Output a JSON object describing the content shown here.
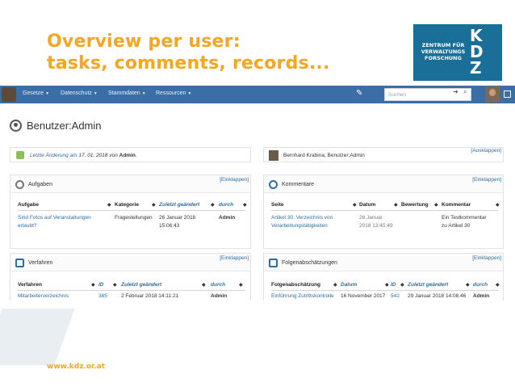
{
  "slide": {
    "title_line1": "Overview per user:",
    "title_line2": "tasks, comments, records...",
    "footer_url": "www.kdz.or.at",
    "accent": "#f5a623"
  },
  "logo": {
    "line1": "ZENTRUM FÜR",
    "line2": "VERWALTUNGS",
    "line3": "FORSCHUNG",
    "k": "K",
    "d": "D",
    "z": "Z",
    "color": "#1a6f98"
  },
  "navbar": {
    "items": [
      "Gesetze",
      "Datenschutz",
      "Stammdaten",
      "Ressourcen"
    ],
    "search_placeholder": "Suchen",
    "color": "#3a6ea5"
  },
  "page": {
    "title": "Benutzer:Admin"
  },
  "last_change": {
    "link": "Letzte Änderung am",
    "date": "17. 01. 2018",
    "von": "von",
    "user": "Admin",
    "dot": "."
  },
  "author": {
    "name": "Bernhard Krabina, Benutzer:Admin",
    "action": "[Ausklappen]"
  },
  "aufgaben": {
    "title": "Aufgaben",
    "action": "[Einklappen]",
    "headers": [
      "Aufgabe",
      "Kategorie",
      "Zuletzt geändert",
      "durch"
    ],
    "row": {
      "task_l1": "Sind Fotos auf Veranstaltungen",
      "task_l2": "erlaubt?",
      "category": "Fragestellungen",
      "date_l1": "26 Januar 2018",
      "date_l2": "15:06:43",
      "by": "Admin"
    }
  },
  "kommentare": {
    "title": "Kommentare",
    "action": "[Einklappen]",
    "headers": [
      "Seite",
      "Datum",
      "Bewertung",
      "Kommentar"
    ],
    "row": {
      "page_l1": "Artikel 30. Verzeichnis von",
      "page_l2": "Verarbeitungstätigkeiten",
      "date_l1": "26 Januar",
      "date_l2": "2018 13:45:49",
      "comment_l1": "Ein Testkommentar",
      "comment_l2": "zu Artikel 30"
    }
  },
  "verfahren": {
    "title": "Verfahren",
    "action": "[Einklappen]",
    "headers": [
      "Verfahren",
      "ID",
      "Zuletzt geändert",
      "durch"
    ],
    "row": {
      "name": "Mitarbeiterverzeichnis",
      "id": "385",
      "date": "2 Februar 2018 14:11:21",
      "by": "Admin"
    }
  },
  "folgen": {
    "title": "Folgenabschätzungen",
    "action": "[Einklappen]",
    "headers": [
      "Folgenabschätzung",
      "Datum",
      "ID",
      "Zuletzt geändert",
      "durch"
    ],
    "row": {
      "name": "Einführung Zutrittskontrolle",
      "date": "16 November 2017",
      "id": "542",
      "changed": "29 Januar 2018 14:08:46",
      "by": "Admin"
    }
  }
}
